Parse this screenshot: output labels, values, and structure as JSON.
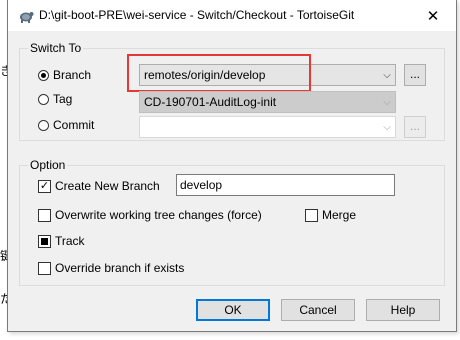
{
  "window": {
    "title": "D:\\git-boot-PRE\\wei-service - Switch/Checkout - TortoiseGit",
    "icons": {
      "app": "tortoisegit-icon",
      "close": "close-icon"
    },
    "close_glyph": "✕"
  },
  "background_glyphs": [
    "き",
    "键",
    "た"
  ],
  "switch_to": {
    "legend": "Switch To",
    "branch": {
      "label": "Branch",
      "selected": true,
      "value": "remotes/origin/develop"
    },
    "tag": {
      "label": "Tag",
      "selected": false,
      "value": "CD-190701-AuditLog-init"
    },
    "commit": {
      "label": "Commit",
      "selected": false,
      "value": ""
    },
    "browse_label": "...",
    "accent": "#e53935"
  },
  "option": {
    "legend": "Option",
    "create_new_branch": {
      "label": "Create New Branch",
      "checked": true,
      "value": "develop"
    },
    "overwrite": {
      "label": "Overwrite working tree changes (force)",
      "checked": false
    },
    "merge": {
      "label": "Merge",
      "checked": false
    },
    "track": {
      "label": "Track",
      "state": "indeterminate"
    },
    "override": {
      "label": "Override branch if exists",
      "checked": false
    }
  },
  "buttons": {
    "ok": "OK",
    "cancel": "Cancel",
    "help": "Help"
  },
  "colors": {
    "default_button_border": "#0078d7"
  }
}
